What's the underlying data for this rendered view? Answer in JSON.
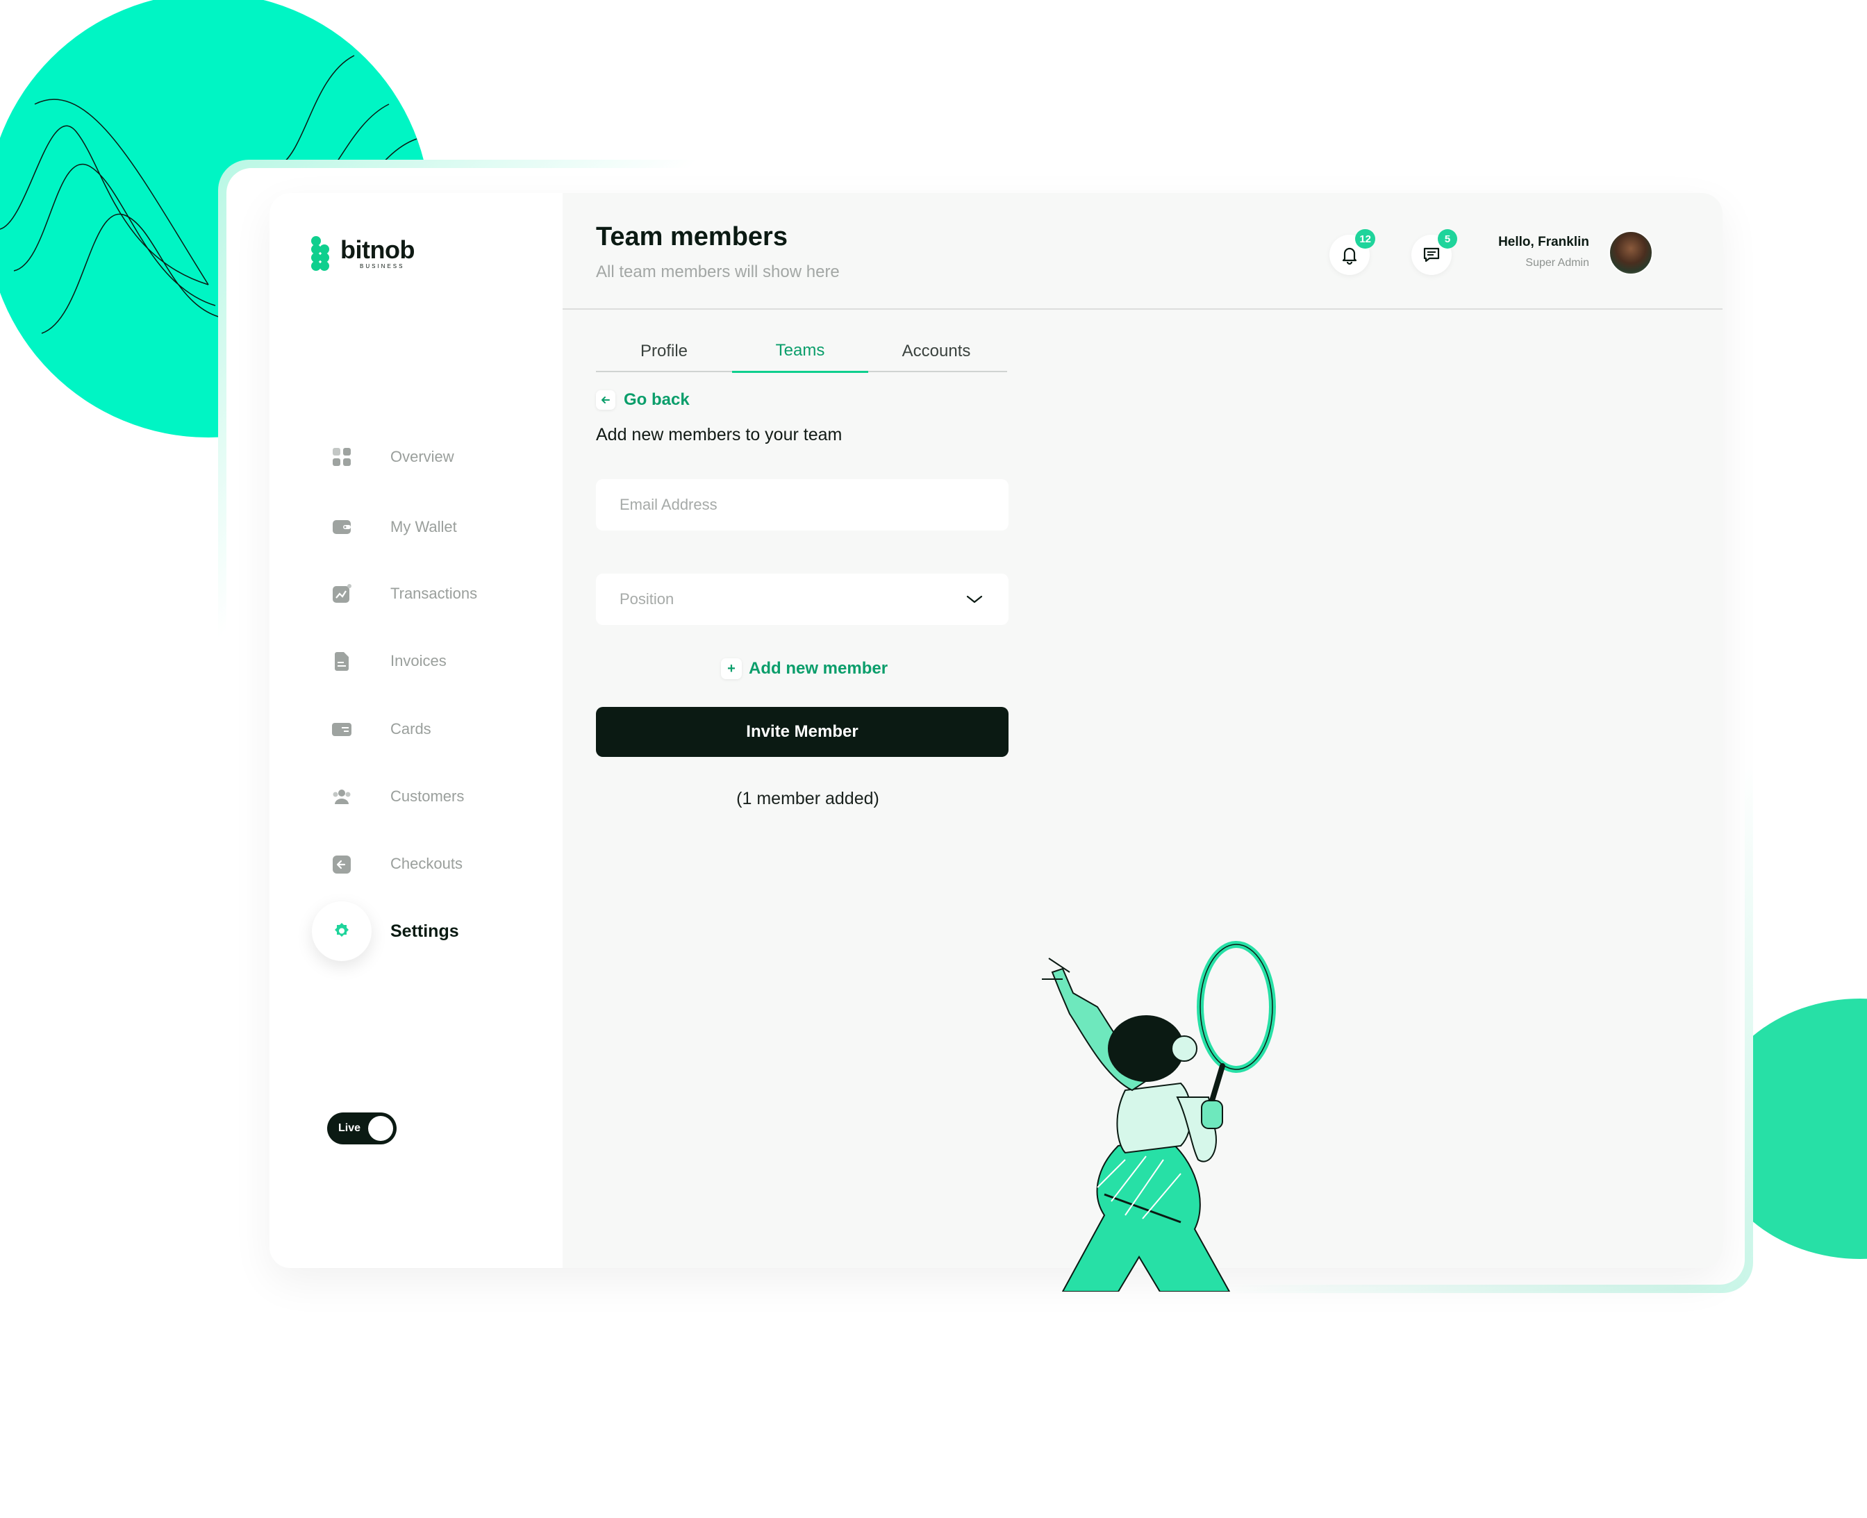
{
  "brand": {
    "name": "bitnob",
    "tagline": "BUSINESS"
  },
  "sidebar": {
    "items": [
      {
        "label": "Overview",
        "icon": "grid-icon"
      },
      {
        "label": "My Wallet",
        "icon": "wallet-icon"
      },
      {
        "label": "Transactions",
        "icon": "chart-icon"
      },
      {
        "label": "Invoices",
        "icon": "document-icon"
      },
      {
        "label": "Cards",
        "icon": "card-icon"
      },
      {
        "label": "Customers",
        "icon": "users-icon"
      },
      {
        "label": "Checkouts",
        "icon": "checkout-icon"
      },
      {
        "label": "Settings",
        "icon": "gear-icon",
        "active": true
      }
    ],
    "live_toggle": {
      "label": "Live",
      "on": true
    }
  },
  "header": {
    "title": "Team members",
    "subtitle": "All team members will show here",
    "notifications_count": "12",
    "messages_count": "5",
    "greeting": "Hello, Franklin",
    "role": "Super Admin"
  },
  "tabs": [
    {
      "label": "Profile"
    },
    {
      "label": "Teams",
      "active": true
    },
    {
      "label": "Accounts"
    }
  ],
  "form": {
    "back_label": "Go back",
    "intro": "Add new members to your team",
    "email_placeholder": "Email Address",
    "position_placeholder": "Position",
    "add_member_label": "Add new member",
    "invite_label": "Invite Member",
    "member_count": "(1 member added)"
  },
  "colors": {
    "accent": "#0fcf8e",
    "accent_text": "#0b9e6b",
    "dark": "#0b1a13",
    "muted": "#9a9f9c"
  }
}
